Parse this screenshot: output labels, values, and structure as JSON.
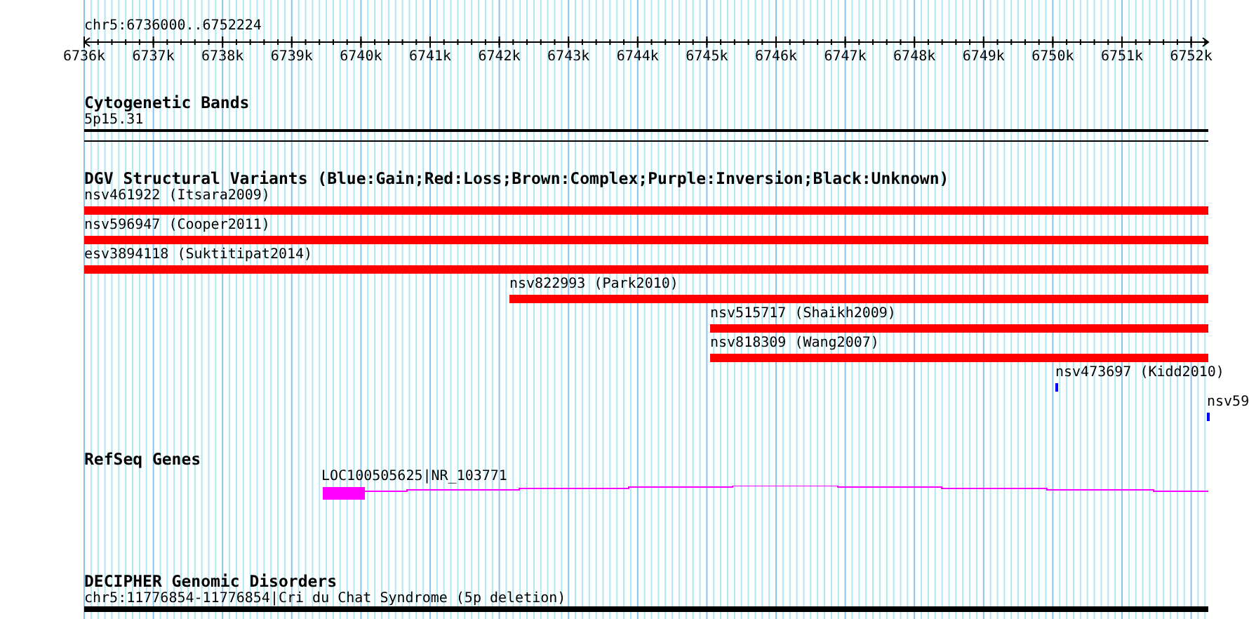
{
  "ruler": {
    "title": "chr5:6736000..6752224",
    "ticks": [
      "6736k",
      "6737k",
      "6738k",
      "6739k",
      "6740k",
      "6741k",
      "6742k",
      "6743k",
      "6744k",
      "6745k",
      "6746k",
      "6747k",
      "6748k",
      "6749k",
      "6750k",
      "6751k",
      "6752k"
    ]
  },
  "tracks": [
    {
      "kind": "cytoband",
      "title": "Cytogenetic Bands",
      "features": [
        {
          "label": "5p15.31"
        }
      ]
    },
    {
      "kind": "variants",
      "title": "DGV Structural Variants (Blue:Gain;Red:Loss;Brown:Complex;Purple:Inversion;Black:Unknown)",
      "features": [
        {
          "label": "nsv461922 (Itsara2009)",
          "color": "#ff0000"
        },
        {
          "label": "nsv596947 (Cooper2011)",
          "color": "#ff0000"
        },
        {
          "label": "esv3894118 (Suktitipat2014)",
          "color": "#ff0000"
        },
        {
          "label": "nsv822993 (Park2010)",
          "color": "#ff0000"
        },
        {
          "label": "nsv515717 (Shaikh2009)",
          "color": "#ff0000"
        },
        {
          "label": "nsv818309 (Wang2007)",
          "color": "#ff0000"
        },
        {
          "label": "nsv473697 (Kidd2010)",
          "color": "#0000ff"
        },
        {
          "label": "nsv59",
          "color": "#0000ff"
        }
      ]
    },
    {
      "kind": "genes",
      "title": "RefSeq Genes",
      "features": [
        {
          "label": "LOC100505625|NR_103771"
        }
      ]
    },
    {
      "kind": "disorders",
      "title": "DECIPHER Genomic Disorders",
      "features": [
        {
          "label": "chr5:11776854-11776854|Cri du Chat Syndrome (5p deletion)"
        }
      ]
    }
  ]
}
